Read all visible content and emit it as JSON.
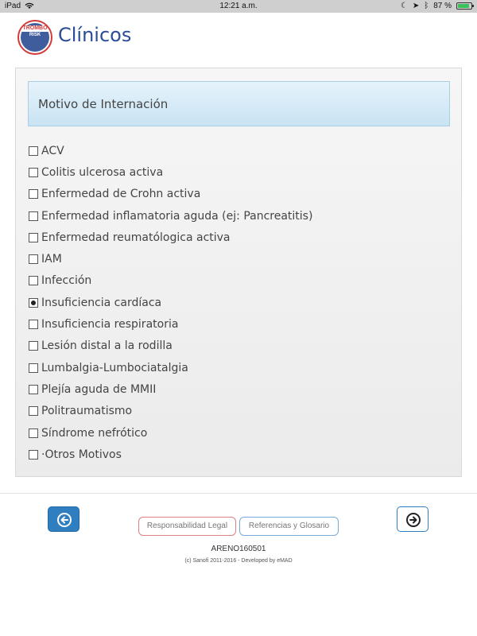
{
  "status_bar": {
    "device": "iPad",
    "time": "12:21 a.m.",
    "battery": "87 %"
  },
  "header": {
    "logo_top": "TROMBO",
    "logo_bottom": "RISK",
    "title": "Clínicos"
  },
  "section": {
    "title": "Motivo de Internación"
  },
  "options": [
    {
      "label": "ACV",
      "checked": false
    },
    {
      "label": "Colitis ulcerosa activa",
      "checked": false
    },
    {
      "label": "Enfermedad de Crohn activa",
      "checked": false
    },
    {
      "label": "Enfermedad inflamatoria aguda (ej: Pancreatitis)",
      "checked": false
    },
    {
      "label": "Enfermedad reumatólogica activa",
      "checked": false
    },
    {
      "label": "IAM",
      "checked": false
    },
    {
      "label": "Infección",
      "checked": false
    },
    {
      "label": "Insuficiencia cardíaca",
      "checked": true
    },
    {
      "label": "Insuficiencia respiratoria",
      "checked": false
    },
    {
      "label": "Lesión distal a la rodilla",
      "checked": false
    },
    {
      "label": "Lumbalgia-Lumbociatalgia",
      "checked": false
    },
    {
      "label": "Plejía aguda de MMII",
      "checked": false
    },
    {
      "label": "Politraumatismo",
      "checked": false
    },
    {
      "label": "Síndrome nefrótico",
      "checked": false
    },
    {
      "label": "·Otros Motivos",
      "checked": false
    }
  ],
  "footer": {
    "legal_label": "Responsabilidad Legal",
    "references_label": "Referencias y Glosario",
    "code": "ARENO160501",
    "copyright": "(c) Sanofi 2011-2016 - Developed by eMAD"
  },
  "colors": {
    "brand": "#2a4c9a",
    "accent": "#2f7fc0",
    "header_band": "#c8e3f3"
  },
  "icons": [
    "wifi-icon",
    "location-arrow-icon",
    "bluetooth-icon",
    "battery-icon",
    "moon-icon",
    "arrow-left-icon",
    "arrow-right-icon"
  ]
}
